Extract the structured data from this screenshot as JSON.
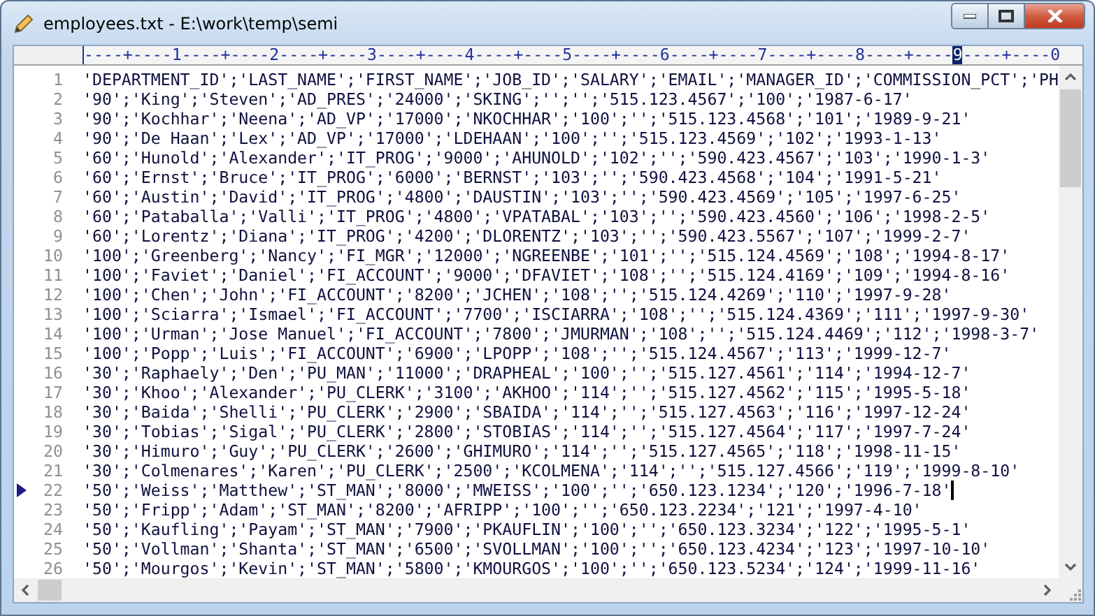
{
  "window": {
    "title": "employees.txt - E:\\work\\temp\\semi"
  },
  "ruler": {
    "segments": [
      {
        "text": "----+----",
        "label": "1",
        "selected": false
      },
      {
        "text": "----+----",
        "label": "2",
        "selected": false
      },
      {
        "text": "----+----",
        "label": "3",
        "selected": false
      },
      {
        "text": "----+----",
        "label": "4",
        "selected": false
      },
      {
        "text": "----+----",
        "label": "5",
        "selected": false
      },
      {
        "text": "----+----",
        "label": "6",
        "selected": false
      },
      {
        "text": "----+----",
        "label": "7",
        "selected": false
      },
      {
        "text": "----+----",
        "label": "8",
        "selected": false
      },
      {
        "text": "----+----",
        "label": "9",
        "selected": true
      },
      {
        "text": "----+----",
        "label": "0",
        "selected": false
      }
    ]
  },
  "lines": [
    {
      "number": "1",
      "text": "'DEPARTMENT_ID';'LAST_NAME';'FIRST_NAME';'JOB_ID';'SALARY';'EMAIL';'MANAGER_ID';'COMMISSION_PCT';'PH",
      "current": false
    },
    {
      "number": "2",
      "text": "'90';'King';'Steven';'AD_PRES';'24000';'SKING';'';'';'515.123.4567';'100';'1987-6-17'",
      "current": false
    },
    {
      "number": "3",
      "text": "'90';'Kochhar';'Neena';'AD_VP';'17000';'NKOCHHAR';'100';'';'515.123.4568';'101';'1989-9-21'",
      "current": false
    },
    {
      "number": "4",
      "text": "'90';'De Haan';'Lex';'AD_VP';'17000';'LDEHAAN';'100';'';'515.123.4569';'102';'1993-1-13'",
      "current": false
    },
    {
      "number": "5",
      "text": "'60';'Hunold';'Alexander';'IT_PROG';'9000';'AHUNOLD';'102';'';'590.423.4567';'103';'1990-1-3'",
      "current": false
    },
    {
      "number": "6",
      "text": "'60';'Ernst';'Bruce';'IT_PROG';'6000';'BERNST';'103';'';'590.423.4568';'104';'1991-5-21'",
      "current": false
    },
    {
      "number": "7",
      "text": "'60';'Austin';'David';'IT_PROG';'4800';'DAUSTIN';'103';'';'590.423.4569';'105';'1997-6-25'",
      "current": false
    },
    {
      "number": "8",
      "text": "'60';'Pataballa';'Valli';'IT_PROG';'4800';'VPATABAL';'103';'';'590.423.4560';'106';'1998-2-5'",
      "current": false
    },
    {
      "number": "9",
      "text": "'60';'Lorentz';'Diana';'IT_PROG';'4200';'DLORENTZ';'103';'';'590.423.5567';'107';'1999-2-7'",
      "current": false
    },
    {
      "number": "10",
      "text": "'100';'Greenberg';'Nancy';'FI_MGR';'12000';'NGREENBE';'101';'';'515.124.4569';'108';'1994-8-17'",
      "current": false
    },
    {
      "number": "11",
      "text": "'100';'Faviet';'Daniel';'FI_ACCOUNT';'9000';'DFAVIET';'108';'';'515.124.4169';'109';'1994-8-16'",
      "current": false
    },
    {
      "number": "12",
      "text": "'100';'Chen';'John';'FI_ACCOUNT';'8200';'JCHEN';'108';'';'515.124.4269';'110';'1997-9-28'",
      "current": false
    },
    {
      "number": "13",
      "text": "'100';'Sciarra';'Ismael';'FI_ACCOUNT';'7700';'ISCIARRA';'108';'';'515.124.4369';'111';'1997-9-30'",
      "current": false
    },
    {
      "number": "14",
      "text": "'100';'Urman';'Jose Manuel';'FI_ACCOUNT';'7800';'JMURMAN';'108';'';'515.124.4469';'112';'1998-3-7'",
      "current": false
    },
    {
      "number": "15",
      "text": "'100';'Popp';'Luis';'FI_ACCOUNT';'6900';'LPOPP';'108';'';'515.124.4567';'113';'1999-12-7'",
      "current": false
    },
    {
      "number": "16",
      "text": "'30';'Raphaely';'Den';'PU_MAN';'11000';'DRAPHEAL';'100';'';'515.127.4561';'114';'1994-12-7'",
      "current": false
    },
    {
      "number": "17",
      "text": "'30';'Khoo';'Alexander';'PU_CLERK';'3100';'AKHOO';'114';'';'515.127.4562';'115';'1995-5-18'",
      "current": false
    },
    {
      "number": "18",
      "text": "'30';'Baida';'Shelli';'PU_CLERK';'2900';'SBAIDA';'114';'';'515.127.4563';'116';'1997-12-24'",
      "current": false
    },
    {
      "number": "19",
      "text": "'30';'Tobias';'Sigal';'PU_CLERK';'2800';'STOBIAS';'114';'';'515.127.4564';'117';'1997-7-24'",
      "current": false
    },
    {
      "number": "20",
      "text": "'30';'Himuro';'Guy';'PU_CLERK';'2600';'GHIMURO';'114';'';'515.127.4565';'118';'1998-11-15'",
      "current": false
    },
    {
      "number": "21",
      "text": "'30';'Colmenares';'Karen';'PU_CLERK';'2500';'KCOLMENA';'114';'';'515.127.4566';'119';'1999-8-10'",
      "current": false
    },
    {
      "number": "22",
      "text": "'50';'Weiss';'Matthew';'ST_MAN';'8000';'MWEISS';'100';'';'650.123.1234';'120';'1996-7-18'",
      "current": true
    },
    {
      "number": "23",
      "text": "'50';'Fripp';'Adam';'ST_MAN';'8200';'AFRIPP';'100';'';'650.123.2234';'121';'1997-4-10'",
      "current": false
    },
    {
      "number": "24",
      "text": "'50';'Kaufling';'Payam';'ST_MAN';'7900';'PKAUFLIN';'100';'';'650.123.3234';'122';'1995-5-1'",
      "current": false
    },
    {
      "number": "25",
      "text": "'50';'Vollman';'Shanta';'ST_MAN';'6500';'SVOLLMAN';'100';'';'650.123.4234';'123';'1997-10-10'",
      "current": false
    },
    {
      "number": "26",
      "text": "'50';'Mourgos';'Kevin';'ST_MAN';'5800';'KMOURGOS';'100';'';'650.123.5234';'124';'1999-11-16'",
      "current": false
    }
  ]
}
